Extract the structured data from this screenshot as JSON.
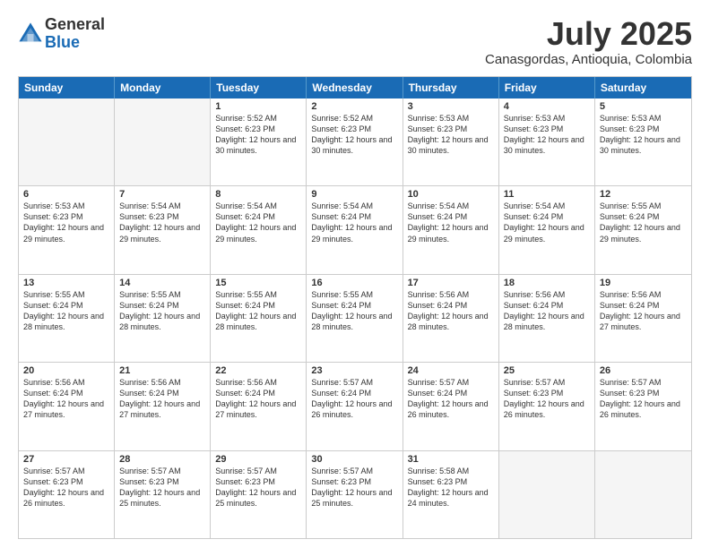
{
  "logo": {
    "general": "General",
    "blue": "Blue"
  },
  "title": "July 2025",
  "location": "Canasgordas, Antioquia, Colombia",
  "days": [
    "Sunday",
    "Monday",
    "Tuesday",
    "Wednesday",
    "Thursday",
    "Friday",
    "Saturday"
  ],
  "weeks": [
    [
      {
        "num": "",
        "sunrise": "",
        "sunset": "",
        "daylight": "",
        "empty": true
      },
      {
        "num": "",
        "sunrise": "",
        "sunset": "",
        "daylight": "",
        "empty": true
      },
      {
        "num": "1",
        "sunrise": "Sunrise: 5:52 AM",
        "sunset": "Sunset: 6:23 PM",
        "daylight": "Daylight: 12 hours and 30 minutes."
      },
      {
        "num": "2",
        "sunrise": "Sunrise: 5:52 AM",
        "sunset": "Sunset: 6:23 PM",
        "daylight": "Daylight: 12 hours and 30 minutes."
      },
      {
        "num": "3",
        "sunrise": "Sunrise: 5:53 AM",
        "sunset": "Sunset: 6:23 PM",
        "daylight": "Daylight: 12 hours and 30 minutes."
      },
      {
        "num": "4",
        "sunrise": "Sunrise: 5:53 AM",
        "sunset": "Sunset: 6:23 PM",
        "daylight": "Daylight: 12 hours and 30 minutes."
      },
      {
        "num": "5",
        "sunrise": "Sunrise: 5:53 AM",
        "sunset": "Sunset: 6:23 PM",
        "daylight": "Daylight: 12 hours and 30 minutes."
      }
    ],
    [
      {
        "num": "6",
        "sunrise": "Sunrise: 5:53 AM",
        "sunset": "Sunset: 6:23 PM",
        "daylight": "Daylight: 12 hours and 29 minutes."
      },
      {
        "num": "7",
        "sunrise": "Sunrise: 5:54 AM",
        "sunset": "Sunset: 6:23 PM",
        "daylight": "Daylight: 12 hours and 29 minutes."
      },
      {
        "num": "8",
        "sunrise": "Sunrise: 5:54 AM",
        "sunset": "Sunset: 6:24 PM",
        "daylight": "Daylight: 12 hours and 29 minutes."
      },
      {
        "num": "9",
        "sunrise": "Sunrise: 5:54 AM",
        "sunset": "Sunset: 6:24 PM",
        "daylight": "Daylight: 12 hours and 29 minutes."
      },
      {
        "num": "10",
        "sunrise": "Sunrise: 5:54 AM",
        "sunset": "Sunset: 6:24 PM",
        "daylight": "Daylight: 12 hours and 29 minutes."
      },
      {
        "num": "11",
        "sunrise": "Sunrise: 5:54 AM",
        "sunset": "Sunset: 6:24 PM",
        "daylight": "Daylight: 12 hours and 29 minutes."
      },
      {
        "num": "12",
        "sunrise": "Sunrise: 5:55 AM",
        "sunset": "Sunset: 6:24 PM",
        "daylight": "Daylight: 12 hours and 29 minutes."
      }
    ],
    [
      {
        "num": "13",
        "sunrise": "Sunrise: 5:55 AM",
        "sunset": "Sunset: 6:24 PM",
        "daylight": "Daylight: 12 hours and 28 minutes."
      },
      {
        "num": "14",
        "sunrise": "Sunrise: 5:55 AM",
        "sunset": "Sunset: 6:24 PM",
        "daylight": "Daylight: 12 hours and 28 minutes."
      },
      {
        "num": "15",
        "sunrise": "Sunrise: 5:55 AM",
        "sunset": "Sunset: 6:24 PM",
        "daylight": "Daylight: 12 hours and 28 minutes."
      },
      {
        "num": "16",
        "sunrise": "Sunrise: 5:55 AM",
        "sunset": "Sunset: 6:24 PM",
        "daylight": "Daylight: 12 hours and 28 minutes."
      },
      {
        "num": "17",
        "sunrise": "Sunrise: 5:56 AM",
        "sunset": "Sunset: 6:24 PM",
        "daylight": "Daylight: 12 hours and 28 minutes."
      },
      {
        "num": "18",
        "sunrise": "Sunrise: 5:56 AM",
        "sunset": "Sunset: 6:24 PM",
        "daylight": "Daylight: 12 hours and 28 minutes."
      },
      {
        "num": "19",
        "sunrise": "Sunrise: 5:56 AM",
        "sunset": "Sunset: 6:24 PM",
        "daylight": "Daylight: 12 hours and 27 minutes."
      }
    ],
    [
      {
        "num": "20",
        "sunrise": "Sunrise: 5:56 AM",
        "sunset": "Sunset: 6:24 PM",
        "daylight": "Daylight: 12 hours and 27 minutes."
      },
      {
        "num": "21",
        "sunrise": "Sunrise: 5:56 AM",
        "sunset": "Sunset: 6:24 PM",
        "daylight": "Daylight: 12 hours and 27 minutes."
      },
      {
        "num": "22",
        "sunrise": "Sunrise: 5:56 AM",
        "sunset": "Sunset: 6:24 PM",
        "daylight": "Daylight: 12 hours and 27 minutes."
      },
      {
        "num": "23",
        "sunrise": "Sunrise: 5:57 AM",
        "sunset": "Sunset: 6:24 PM",
        "daylight": "Daylight: 12 hours and 26 minutes."
      },
      {
        "num": "24",
        "sunrise": "Sunrise: 5:57 AM",
        "sunset": "Sunset: 6:24 PM",
        "daylight": "Daylight: 12 hours and 26 minutes."
      },
      {
        "num": "25",
        "sunrise": "Sunrise: 5:57 AM",
        "sunset": "Sunset: 6:23 PM",
        "daylight": "Daylight: 12 hours and 26 minutes."
      },
      {
        "num": "26",
        "sunrise": "Sunrise: 5:57 AM",
        "sunset": "Sunset: 6:23 PM",
        "daylight": "Daylight: 12 hours and 26 minutes."
      }
    ],
    [
      {
        "num": "27",
        "sunrise": "Sunrise: 5:57 AM",
        "sunset": "Sunset: 6:23 PM",
        "daylight": "Daylight: 12 hours and 26 minutes."
      },
      {
        "num": "28",
        "sunrise": "Sunrise: 5:57 AM",
        "sunset": "Sunset: 6:23 PM",
        "daylight": "Daylight: 12 hours and 25 minutes."
      },
      {
        "num": "29",
        "sunrise": "Sunrise: 5:57 AM",
        "sunset": "Sunset: 6:23 PM",
        "daylight": "Daylight: 12 hours and 25 minutes."
      },
      {
        "num": "30",
        "sunrise": "Sunrise: 5:57 AM",
        "sunset": "Sunset: 6:23 PM",
        "daylight": "Daylight: 12 hours and 25 minutes."
      },
      {
        "num": "31",
        "sunrise": "Sunrise: 5:58 AM",
        "sunset": "Sunset: 6:23 PM",
        "daylight": "Daylight: 12 hours and 24 minutes."
      },
      {
        "num": "",
        "sunrise": "",
        "sunset": "",
        "daylight": "",
        "empty": true
      },
      {
        "num": "",
        "sunrise": "",
        "sunset": "",
        "daylight": "",
        "empty": true
      }
    ]
  ]
}
